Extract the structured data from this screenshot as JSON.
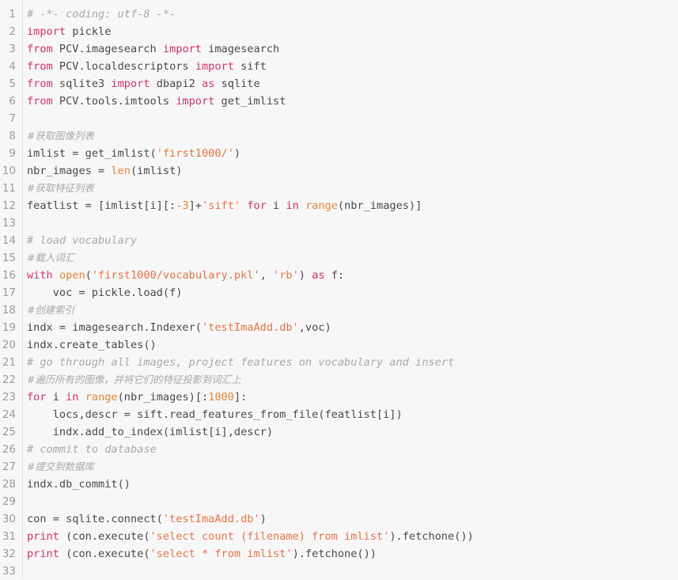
{
  "editor": {
    "name": "python-code-viewer",
    "language": "Python",
    "background_color": "#f7f7f7",
    "gutter_color": "#9b9b9b",
    "rule_color": "#dcdcdc",
    "colors": {
      "keyword": "#d6316f",
      "builtin": "#e8833a",
      "string": "#e8734a",
      "number": "#e8833a",
      "comment": "#a8a8a8",
      "plain": "#4a4a4a"
    },
    "total_lines": 33,
    "line_numbers": [
      "1",
      "2",
      "3",
      "4",
      "5",
      "6",
      "7",
      "8",
      "9",
      "10",
      "11",
      "12",
      "13",
      "14",
      "15",
      "16",
      "17",
      "18",
      "19",
      "20",
      "21",
      "22",
      "23",
      "24",
      "25",
      "26",
      "27",
      "28",
      "29",
      "30",
      "31",
      "32",
      "33"
    ],
    "lines": [
      {
        "n": "1",
        "tokens": [
          {
            "t": "# -*- coding: utf-8 -*-",
            "c": "com"
          }
        ]
      },
      {
        "n": "2",
        "tokens": [
          {
            "t": "import",
            "c": "kw"
          },
          {
            "t": " pickle",
            "c": "plain"
          }
        ]
      },
      {
        "n": "3",
        "tokens": [
          {
            "t": "from",
            "c": "kw"
          },
          {
            "t": " PCV.imagesearch ",
            "c": "plain"
          },
          {
            "t": "import",
            "c": "kw"
          },
          {
            "t": " imagesearch",
            "c": "plain"
          }
        ]
      },
      {
        "n": "4",
        "tokens": [
          {
            "t": "from",
            "c": "kw"
          },
          {
            "t": " PCV.localdescriptors ",
            "c": "plain"
          },
          {
            "t": "import",
            "c": "kw"
          },
          {
            "t": " sift",
            "c": "plain"
          }
        ]
      },
      {
        "n": "5",
        "tokens": [
          {
            "t": "from",
            "c": "kw"
          },
          {
            "t": " sqlite3 ",
            "c": "plain"
          },
          {
            "t": "import",
            "c": "kw"
          },
          {
            "t": " dbapi2 ",
            "c": "plain"
          },
          {
            "t": "as",
            "c": "kw"
          },
          {
            "t": " sqlite",
            "c": "plain"
          }
        ]
      },
      {
        "n": "6",
        "tokens": [
          {
            "t": "from",
            "c": "kw"
          },
          {
            "t": " PCV.tools.imtools ",
            "c": "plain"
          },
          {
            "t": "import",
            "c": "kw"
          },
          {
            "t": " get_imlist",
            "c": "plain"
          }
        ]
      },
      {
        "n": "7",
        "tokens": []
      },
      {
        "n": "8",
        "tokens": [
          {
            "t": "#获取图像列表",
            "c": "com-cn"
          }
        ]
      },
      {
        "n": "9",
        "tokens": [
          {
            "t": "imlist = get_imlist(",
            "c": "plain"
          },
          {
            "t": "'first1000/'",
            "c": "str"
          },
          {
            "t": ")",
            "c": "plain"
          }
        ]
      },
      {
        "n": "10",
        "tokens": [
          {
            "t": "nbr_images = ",
            "c": "plain"
          },
          {
            "t": "len",
            "c": "builtin"
          },
          {
            "t": "(imlist)",
            "c": "plain"
          }
        ]
      },
      {
        "n": "11",
        "tokens": [
          {
            "t": "#获取特征列表",
            "c": "com-cn"
          }
        ]
      },
      {
        "n": "12",
        "tokens": [
          {
            "t": "featlist = [imlist[i][:",
            "c": "plain"
          },
          {
            "t": "-3",
            "c": "num"
          },
          {
            "t": "]+",
            "c": "plain"
          },
          {
            "t": "'sift'",
            "c": "str"
          },
          {
            "t": " ",
            "c": "plain"
          },
          {
            "t": "for",
            "c": "kw"
          },
          {
            "t": " i ",
            "c": "plain"
          },
          {
            "t": "in",
            "c": "kw"
          },
          {
            "t": " ",
            "c": "plain"
          },
          {
            "t": "range",
            "c": "builtin"
          },
          {
            "t": "(nbr_images)]",
            "c": "plain"
          }
        ]
      },
      {
        "n": "13",
        "tokens": []
      },
      {
        "n": "14",
        "tokens": [
          {
            "t": "# load vocabulary",
            "c": "com"
          }
        ]
      },
      {
        "n": "15",
        "tokens": [
          {
            "t": "#载入词汇",
            "c": "com-cn"
          }
        ]
      },
      {
        "n": "16",
        "tokens": [
          {
            "t": "with",
            "c": "kw"
          },
          {
            "t": " ",
            "c": "plain"
          },
          {
            "t": "open",
            "c": "builtin"
          },
          {
            "t": "(",
            "c": "plain"
          },
          {
            "t": "'first1000/vocabulary.pkl'",
            "c": "str"
          },
          {
            "t": ", ",
            "c": "plain"
          },
          {
            "t": "'rb'",
            "c": "str"
          },
          {
            "t": ") ",
            "c": "plain"
          },
          {
            "t": "as",
            "c": "kw"
          },
          {
            "t": " f:",
            "c": "plain"
          }
        ]
      },
      {
        "n": "17",
        "tokens": [
          {
            "t": "    voc = pickle.load(f)",
            "c": "plain"
          }
        ]
      },
      {
        "n": "18",
        "tokens": [
          {
            "t": "#创建索引",
            "c": "com-cn"
          }
        ]
      },
      {
        "n": "19",
        "tokens": [
          {
            "t": "indx = imagesearch.Indexer(",
            "c": "plain"
          },
          {
            "t": "'testImaAdd.db'",
            "c": "str"
          },
          {
            "t": ",voc)",
            "c": "plain"
          }
        ]
      },
      {
        "n": "20",
        "tokens": [
          {
            "t": "indx.create_tables()",
            "c": "plain"
          }
        ]
      },
      {
        "n": "21",
        "tokens": [
          {
            "t": "# go through all images, project features on vocabulary and insert",
            "c": "com"
          }
        ]
      },
      {
        "n": "22",
        "tokens": [
          {
            "t": "#遍历所有的图像，并将它们的特征投影到词汇上",
            "c": "com-cn"
          }
        ]
      },
      {
        "n": "23",
        "tokens": [
          {
            "t": "for",
            "c": "kw"
          },
          {
            "t": " i ",
            "c": "plain"
          },
          {
            "t": "in",
            "c": "kw"
          },
          {
            "t": " ",
            "c": "plain"
          },
          {
            "t": "range",
            "c": "builtin"
          },
          {
            "t": "(nbr_images)[:",
            "c": "plain"
          },
          {
            "t": "1000",
            "c": "num"
          },
          {
            "t": "]:",
            "c": "plain"
          }
        ]
      },
      {
        "n": "24",
        "tokens": [
          {
            "t": "    locs,descr = sift.read_features_from_file(featlist[i])",
            "c": "plain"
          }
        ]
      },
      {
        "n": "25",
        "tokens": [
          {
            "t": "    indx.add_to_index(imlist[i],descr)",
            "c": "plain"
          }
        ]
      },
      {
        "n": "26",
        "tokens": [
          {
            "t": "# commit to database",
            "c": "com"
          }
        ]
      },
      {
        "n": "27",
        "tokens": [
          {
            "t": "#提交到数据库",
            "c": "com-cn"
          }
        ]
      },
      {
        "n": "28",
        "tokens": [
          {
            "t": "indx.db_commit()",
            "c": "plain"
          }
        ]
      },
      {
        "n": "29",
        "tokens": []
      },
      {
        "n": "30",
        "tokens": [
          {
            "t": "con = sqlite.connect(",
            "c": "plain"
          },
          {
            "t": "'testImaAdd.db'",
            "c": "str"
          },
          {
            "t": ")",
            "c": "plain"
          }
        ]
      },
      {
        "n": "31",
        "tokens": [
          {
            "t": "print",
            "c": "kw"
          },
          {
            "t": " (con.execute(",
            "c": "plain"
          },
          {
            "t": "'select count (filename) from imlist'",
            "c": "str"
          },
          {
            "t": ").fetchone())",
            "c": "plain"
          }
        ]
      },
      {
        "n": "32",
        "tokens": [
          {
            "t": "print",
            "c": "kw"
          },
          {
            "t": " (con.execute(",
            "c": "plain"
          },
          {
            "t": "'select * from imlist'",
            "c": "str"
          },
          {
            "t": ").fetchone())",
            "c": "plain"
          }
        ]
      },
      {
        "n": "33",
        "tokens": []
      }
    ]
  }
}
